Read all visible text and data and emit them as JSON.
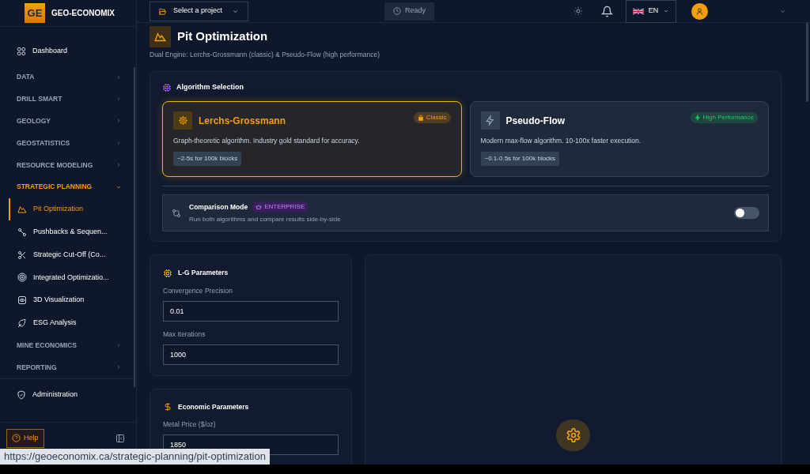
{
  "app": {
    "logo": "GE",
    "name": "GEO-ECONOMIX"
  },
  "sidebar": {
    "items": [
      {
        "kind": "link",
        "label": "Dashboard",
        "selected": false
      },
      {
        "kind": "section",
        "label": "DATA",
        "expanded": false
      },
      {
        "kind": "section",
        "label": "DRILL SMART",
        "expanded": false
      },
      {
        "kind": "section",
        "label": "GEOLOGY",
        "expanded": false
      },
      {
        "kind": "section",
        "label": "GEOSTATISTICS",
        "expanded": false
      },
      {
        "kind": "section",
        "label": "RESOURCE MODELING",
        "expanded": false
      },
      {
        "kind": "section",
        "label": "STRATEGIC PLANNING",
        "expanded": true,
        "children": [
          {
            "label": "Pit Optimization",
            "selected": true
          },
          {
            "label": "Pushbacks & Sequen...",
            "selected": false
          },
          {
            "label": "Strategic Cut-Off (Co...",
            "selected": false
          },
          {
            "label": "Integrated Optimizatio...",
            "selected": false
          },
          {
            "label": "3D Visualization",
            "selected": false
          },
          {
            "label": "ESG Analysis",
            "selected": false
          }
        ]
      },
      {
        "kind": "section",
        "label": "MINE ECONOMICS",
        "expanded": false
      },
      {
        "kind": "section",
        "label": "REPORTING",
        "expanded": false
      }
    ],
    "footer_items": [
      {
        "label": "Administration"
      }
    ],
    "help_button": "Help"
  },
  "topbar": {
    "project_select": "Select a project",
    "status": "Ready",
    "language": "EN"
  },
  "page": {
    "title": "Pit Optimization",
    "subtitle": "Dual Engine: Lerchs-Grossmann (classic) & Pseudo-Flow (high performance)"
  },
  "algorithm_selection": {
    "title": "Algorithm Selection",
    "options": [
      {
        "name": "Lerchs-Grossmann",
        "badge": "Classic",
        "color": "#f59e0b",
        "description": "Graph-theoretic algorithm. Industry gold standard for accuracy.",
        "timing": "~2-5s for 100k blocks",
        "selected": true
      },
      {
        "name": "Pseudo-Flow",
        "badge": "High Performance",
        "color": "#22c55e",
        "description": "Modern max-flow algorithm. 10-100x faster execution.",
        "timing": "~0.1-0.5s for 100k blocks",
        "selected": false
      }
    ],
    "comparison": {
      "title": "Comparison Mode",
      "badge": "ENTERPRISE",
      "description": "Run both algorithms and compare results side-by-side",
      "on": false
    }
  },
  "lg_parameters": {
    "title": "L-G Parameters",
    "fields": [
      {
        "label": "Convergence Precision",
        "value": "0.01"
      },
      {
        "label": "Max Iterations",
        "value": "1000"
      }
    ]
  },
  "economic_parameters": {
    "title": "Economic Parameters",
    "fields": [
      {
        "label": "Metal Price ($/oz)",
        "value": "1850"
      }
    ]
  },
  "status_url": "https://geoeconomix.ca/strategic-planning/pit-optimization"
}
